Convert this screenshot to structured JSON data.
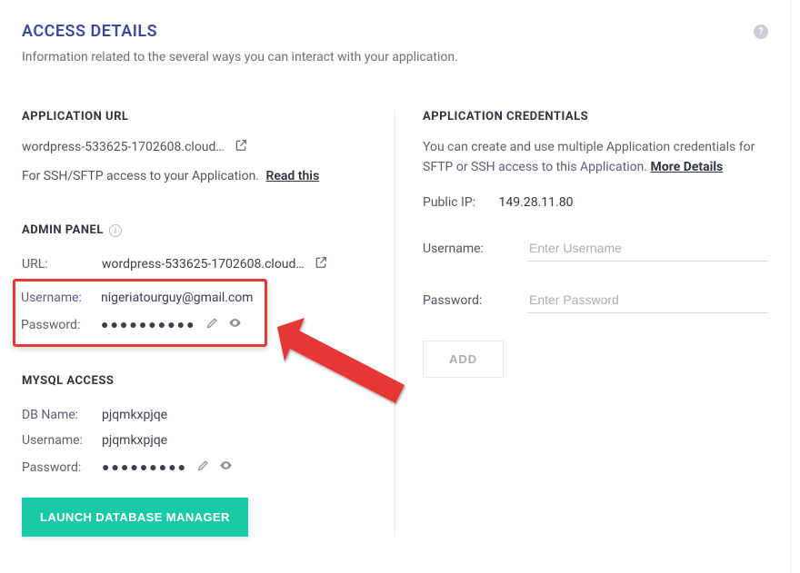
{
  "header": {
    "title": "ACCESS DETAILS",
    "subtitle": "Information related to the several ways you can interact with your application."
  },
  "app_url": {
    "heading": "APPLICATION URL",
    "url": "wordpress-533625-1702608.cloud…",
    "ssh_note": "For SSH/SFTP access to your Application.",
    "read_this": "Read this"
  },
  "admin_panel": {
    "heading": "ADMIN PANEL",
    "url_label": "URL:",
    "url_value": "wordpress-533625-1702608.cloud…",
    "username_label": "Username:",
    "username_value": "nigeriatourguy@gmail.com",
    "password_label": "Password:",
    "password_mask": "●●●●●●●●●●"
  },
  "mysql": {
    "heading": "MYSQL ACCESS",
    "db_label": "DB Name:",
    "db_value": "pjqmkxpjqe",
    "user_label": "Username:",
    "user_value": "pjqmkxpjqe",
    "pwd_label": "Password:",
    "pwd_mask": "●●●●●●●●●",
    "launch_label": "LAUNCH DATABASE MANAGER"
  },
  "credentials": {
    "heading": "APPLICATION CREDENTIALS",
    "desc_prefix": "You can create and use multiple Application credentials for SFTP or SSH access to this Application. ",
    "more_details": "More Details",
    "ip_label": "Public IP:",
    "ip_value": "149.28.11.80",
    "username_label": "Username:",
    "username_placeholder": "Enter Username",
    "password_label": "Password:",
    "password_placeholder": "Enter Password",
    "add_label": "ADD"
  }
}
